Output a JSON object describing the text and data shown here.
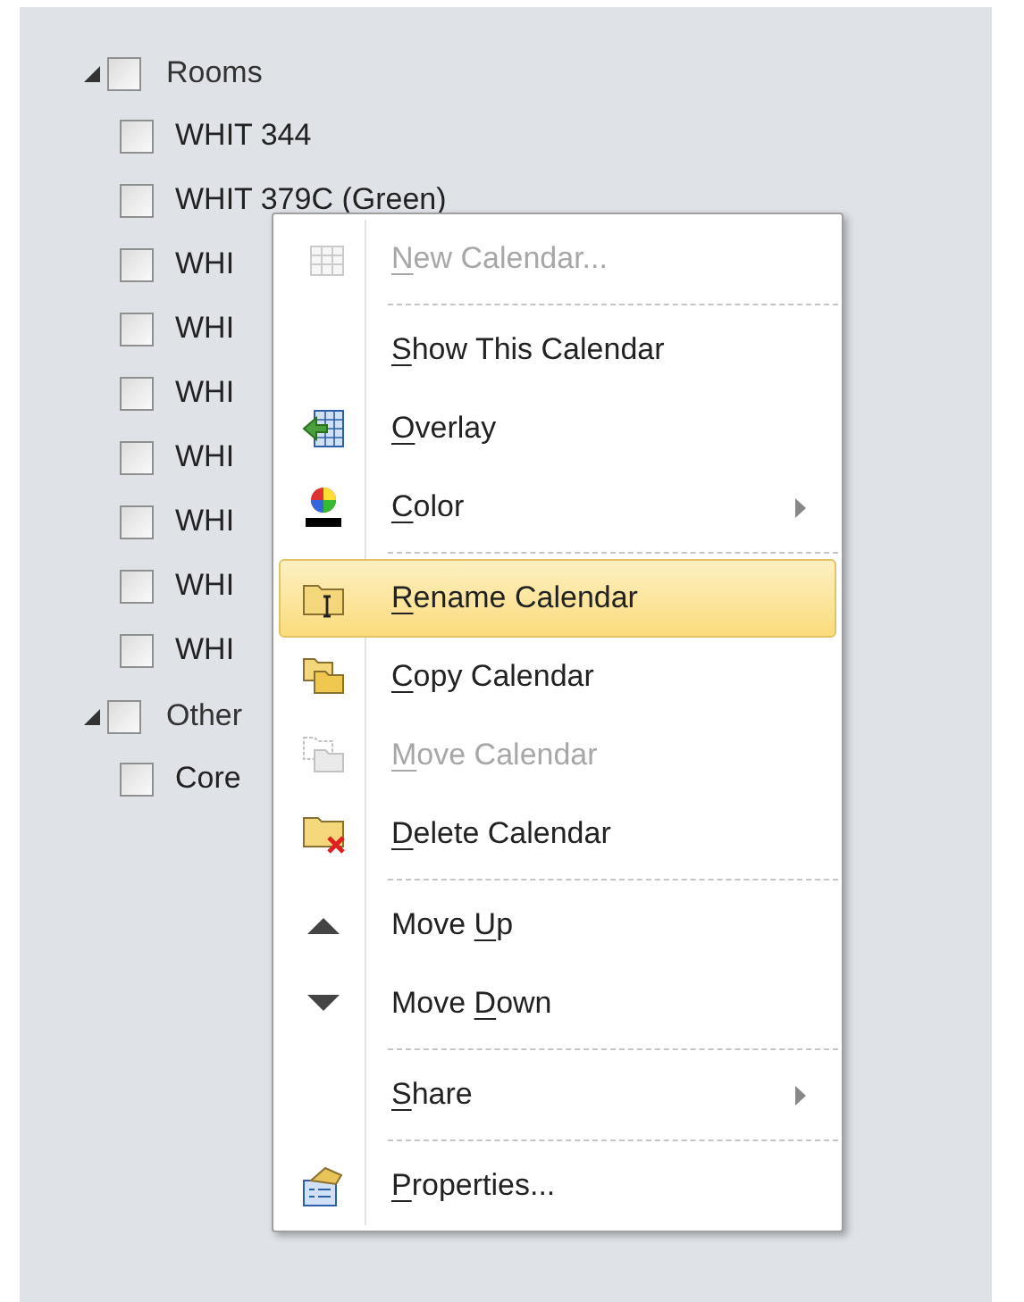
{
  "tree": [
    {
      "label": "Rooms",
      "expanded": true,
      "checked": false,
      "children": [
        {
          "label": "WHIT 344",
          "checked": false
        },
        {
          "label": "WHIT 379C (Green)",
          "checked": false
        },
        {
          "label": "WHI",
          "checked": false
        },
        {
          "label": "WHI",
          "checked": false
        },
        {
          "label": "WHI",
          "checked": false
        },
        {
          "label": "WHI",
          "checked": false
        },
        {
          "label": "WHI",
          "checked": false
        },
        {
          "label": "WHI",
          "checked": false
        },
        {
          "label": "WHI",
          "checked": false
        }
      ]
    },
    {
      "label": "Other",
      "expanded": true,
      "checked": false,
      "children": [
        {
          "label": "Core",
          "checked": false
        }
      ]
    }
  ],
  "context_menu": [
    {
      "kind": "item",
      "key": "N",
      "after": "ew Calendar...",
      "disabled": true,
      "selected": false,
      "submenu": false
    },
    {
      "kind": "separator"
    },
    {
      "kind": "item",
      "key": "S",
      "after": "how This Calendar",
      "disabled": false,
      "selected": false,
      "submenu": false
    },
    {
      "kind": "item",
      "key": "O",
      "after": "verlay",
      "disabled": false,
      "selected": false,
      "submenu": false
    },
    {
      "kind": "item",
      "key": "C",
      "after": "olor",
      "disabled": false,
      "selected": false,
      "submenu": true
    },
    {
      "kind": "separator"
    },
    {
      "kind": "item",
      "key": "R",
      "after": "ename Calendar",
      "disabled": false,
      "selected": true,
      "submenu": false
    },
    {
      "kind": "item",
      "key": "C",
      "after": "opy Calendar",
      "disabled": false,
      "selected": false,
      "submenu": false
    },
    {
      "kind": "item",
      "key": "M",
      "after": "ove Calendar",
      "disabled": true,
      "selected": false,
      "submenu": false
    },
    {
      "kind": "item",
      "key": "D",
      "after": "elete Calendar",
      "disabled": false,
      "selected": false,
      "submenu": false
    },
    {
      "kind": "separator"
    },
    {
      "kind": "item",
      "before": "Move ",
      "key": "U",
      "after": "p",
      "disabled": false,
      "selected": false,
      "submenu": false
    },
    {
      "kind": "item",
      "before": "Move ",
      "key": "D",
      "after": "own",
      "disabled": false,
      "selected": false,
      "submenu": false
    },
    {
      "kind": "separator"
    },
    {
      "kind": "item",
      "key": "S",
      "after": "hare",
      "disabled": false,
      "selected": false,
      "submenu": true
    },
    {
      "kind": "separator"
    },
    {
      "kind": "item",
      "key": "P",
      "after": "roperties...",
      "disabled": false,
      "selected": false,
      "submenu": false
    }
  ]
}
